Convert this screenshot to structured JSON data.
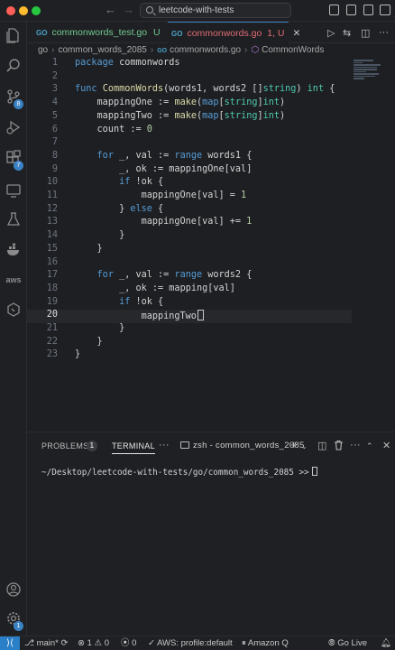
{
  "titlebar": {
    "search_text": "leetcode-with-tests"
  },
  "tabs": [
    {
      "label": "commonwords_test.go",
      "status": "U"
    },
    {
      "label": "commonwords.go",
      "status": "1, U"
    }
  ],
  "breadcrumb": {
    "items": [
      "go",
      "common_words_2085",
      "commonwords.go",
      "CommonWords"
    ]
  },
  "activity": {
    "source_control_badge": "8",
    "extensions_badge": "7",
    "aws_label": "aws",
    "settings_badge": "1"
  },
  "editor": {
    "current_line": 20,
    "line_numbers": [
      "1",
      "2",
      "3",
      "4",
      "5",
      "6",
      "7",
      "8",
      "9",
      "10",
      "11",
      "12",
      "13",
      "14",
      "15",
      "16",
      "17",
      "18",
      "19",
      "20",
      "21",
      "22",
      "23"
    ]
  },
  "panel": {
    "problems_label": "PROBLEMS",
    "problems_count": "1",
    "terminal_label": "TERMINAL",
    "more_label": "···",
    "terminal_name": "zsh - common_words_2085",
    "prompt": "~/Desktop/leetcode-with-tests/go/common_words_2085 >>"
  },
  "statusbar": {
    "branch": "main*",
    "errors": "1",
    "warnings": "0",
    "ports": "0",
    "aws_profile": "AWS: profile:default",
    "amazon_q": "Amazon Q",
    "go_live": "Go Live"
  },
  "colors": {
    "accent": "#3b82c4",
    "keyword": "#569cd6",
    "function": "#dcdcaa",
    "type": "#4ec9b0",
    "number": "#b5cea8",
    "background": "#1e1f22"
  }
}
